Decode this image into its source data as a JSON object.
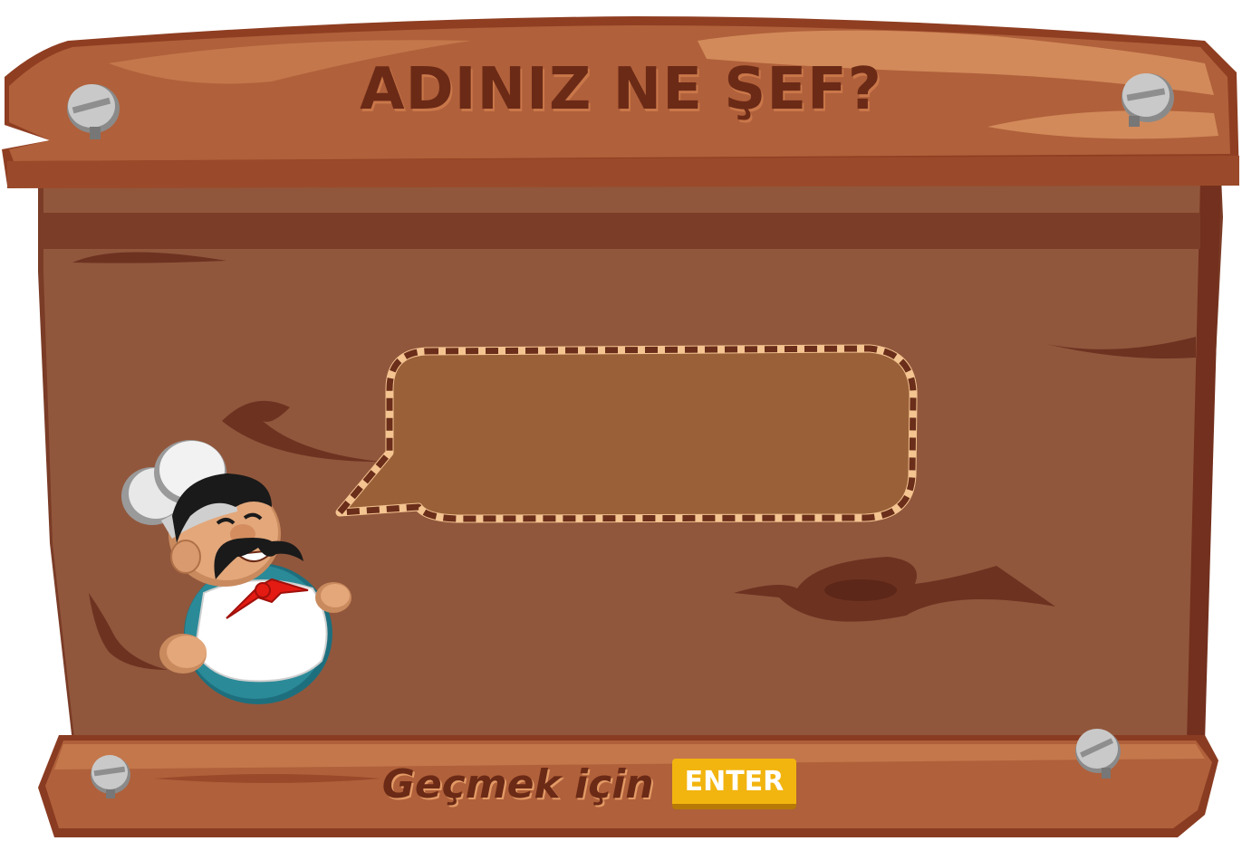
{
  "title": "ADINIZ NE ŞEF?",
  "name_input": {
    "value": "",
    "placeholder": ""
  },
  "footer": {
    "text": "Geçmek için",
    "key_label": "ENTER"
  },
  "colors": {
    "board": "#91573c",
    "board_dark": "#7b3d28",
    "plank": "#b0603a",
    "title_text": "#6b2a16",
    "bubble_fill": "#9a6038",
    "key_yellow": "#f2b40f"
  },
  "icons": [
    "screw-icon",
    "chef-mascot"
  ]
}
